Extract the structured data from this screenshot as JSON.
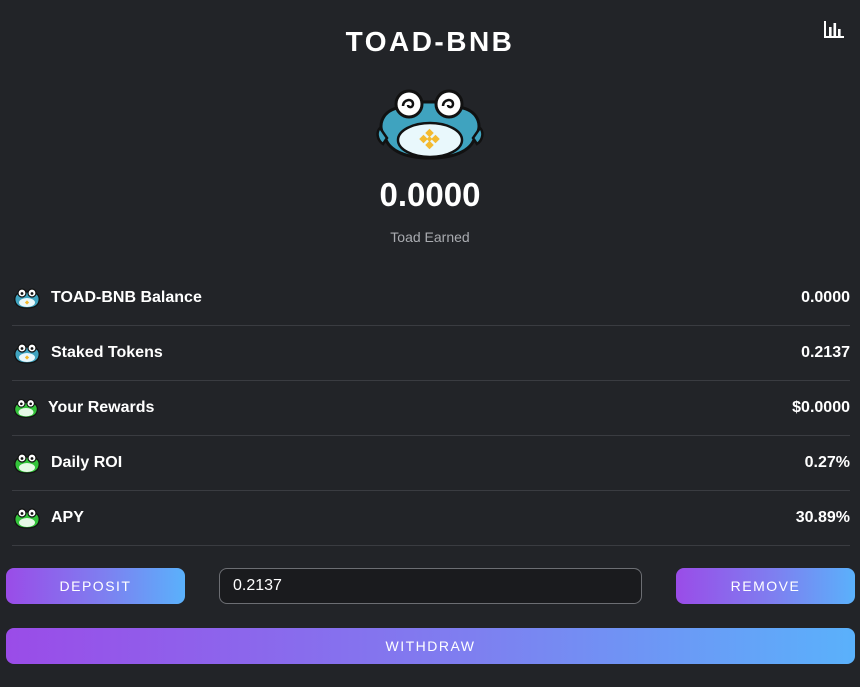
{
  "header": {
    "title": "TOAD-BNB",
    "chart_icon": "bar-chart-icon"
  },
  "earned": {
    "value": "0.0000",
    "label": "Toad Earned"
  },
  "stats": [
    {
      "label": "TOAD-BNB Balance",
      "value": "0.0000",
      "icon": "blue-toad-icon"
    },
    {
      "label": "Staked Tokens",
      "value": "0.2137",
      "icon": "blue-toad-icon"
    },
    {
      "label": "Your Rewards",
      "value": "$0.0000",
      "icon": "green-toad-icon"
    },
    {
      "label": "Daily ROI",
      "value": "0.27%",
      "icon": "green-toad-icon"
    },
    {
      "label": "APY",
      "value": "30.89%",
      "icon": "green-toad-icon"
    }
  ],
  "actions": {
    "deposit_label": "DEPOSIT",
    "amount_value": "0.2137",
    "remove_label": "REMOVE",
    "withdraw_label": "WITHDRAW"
  },
  "colors": {
    "background": "#222428",
    "gradient_start": "#9a4ce8",
    "gradient_end": "#5ab1fb",
    "toad_blue": "#3fa3bf",
    "toad_green": "#33c33a",
    "bnb_yellow": "#f3ba2f"
  }
}
